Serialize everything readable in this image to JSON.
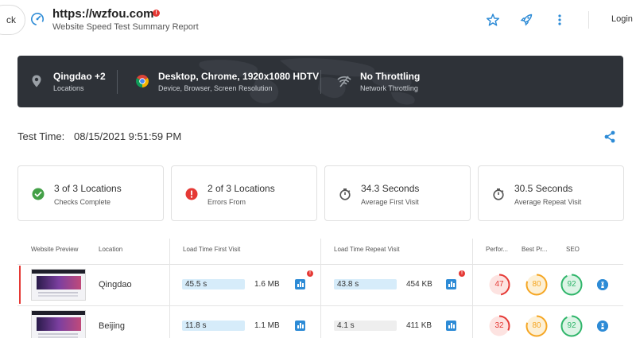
{
  "header": {
    "back_label": "ck",
    "url": "https://wzfou.com",
    "error_badge": "!",
    "subtitle": "Website Speed Test Summary Report",
    "icons": [
      "speedometer-icon",
      "star-icon",
      "rocket-icon",
      "more-vert-icon"
    ],
    "login_label": "Login"
  },
  "banner": {
    "items": [
      {
        "icon": "location-pin-icon",
        "title": "Qingdao +2",
        "subtitle": "Locations"
      },
      {
        "icon": "chrome-icon",
        "title": "Desktop, Chrome, 1920x1080 HDTV",
        "subtitle": "Device, Browser, Screen Resolution"
      },
      {
        "icon": "wifi-icon",
        "title": "No Throttling",
        "subtitle": "Network Throttling"
      }
    ]
  },
  "test_time": {
    "label": "Test Time:",
    "value": "08/15/2021 9:51:59 PM"
  },
  "summary": [
    {
      "icon": "check-circle-icon",
      "color": "#43a047",
      "title": "3 of 3 Locations",
      "subtitle": "Checks Complete"
    },
    {
      "icon": "error-circle-icon",
      "color": "#e53935",
      "title": "2 of 3 Locations",
      "subtitle": "Errors From"
    },
    {
      "icon": "timer-icon",
      "color": "#555555",
      "title": "34.3 Seconds",
      "subtitle": "Average First Visit"
    },
    {
      "icon": "timer-icon",
      "color": "#555555",
      "title": "30.5 Seconds",
      "subtitle": "Average Repeat Visit"
    }
  ],
  "table": {
    "headers": {
      "preview": "Website Preview",
      "location": "Location",
      "first_visit": "Load Time First Visit",
      "repeat_visit": "Load Time Repeat Visit",
      "performance": "Perfor...",
      "best_practices": "Best Pr...",
      "seo": "SEO"
    },
    "rows": [
      {
        "location": "Qingdao",
        "first_time": "45.5 s",
        "first_size": "1.6 MB",
        "first_warn": "!",
        "repeat_time": "43.8 s",
        "repeat_size": "454 KB",
        "repeat_warn": "!",
        "performance": "47",
        "best_practices": "80",
        "seo": "92"
      },
      {
        "location": "Beijing",
        "first_time": "11.8 s",
        "first_size": "1.1 MB",
        "repeat_time": "4.1 s",
        "repeat_size": "411 KB",
        "performance": "32",
        "best_practices": "80",
        "seo": "92"
      }
    ]
  },
  "colors": {
    "accent": "#2d8bd6",
    "error": "#e53935",
    "success": "#43a047",
    "warning": "#f5a623",
    "banner_bg": "#2e3238"
  }
}
